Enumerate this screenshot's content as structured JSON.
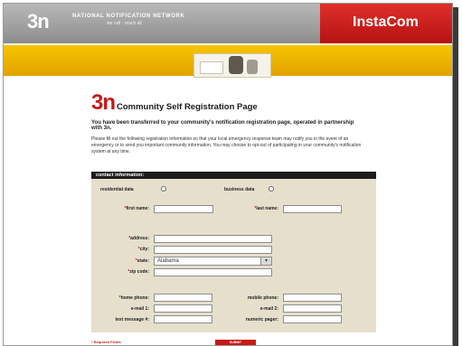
{
  "header": {
    "logo": "3n",
    "network_name": "NATIONAL NOTIFICATION NETWORK",
    "network_tagline": "we call · reach all",
    "brand": "InstaCom"
  },
  "page": {
    "logo": "3n",
    "title": "Community Self Registration Page",
    "subhead": "You have been transferred to your community's notification registration page, operated in partnership with 3n.",
    "intro": "Please fill out the following registration information so that your local emergency response team may notify you in the event of an emergency or to send you important community information. You may choose to opt-out of participating in your community's notification system at any time."
  },
  "form": {
    "section_title": "contact information:",
    "residential_label": "residential data",
    "business_label": "business data",
    "first_name_label": "first name:",
    "last_name_label": "last name:",
    "address_label": "address:",
    "city_label": "city:",
    "state_label": "state:",
    "state_value": "Alabama",
    "zip_label": "zip code:",
    "home_phone_label": "home phone:",
    "mobile_phone_label": "mobile phone:",
    "email1_label": "e-mail 1:",
    "email2_label": "e-mail 2:",
    "text_message_label": "text message #:",
    "numeric_pager_label": "numeric pager:",
    "required_note": "* Required Fields",
    "submit_label": "SUBMIT"
  }
}
